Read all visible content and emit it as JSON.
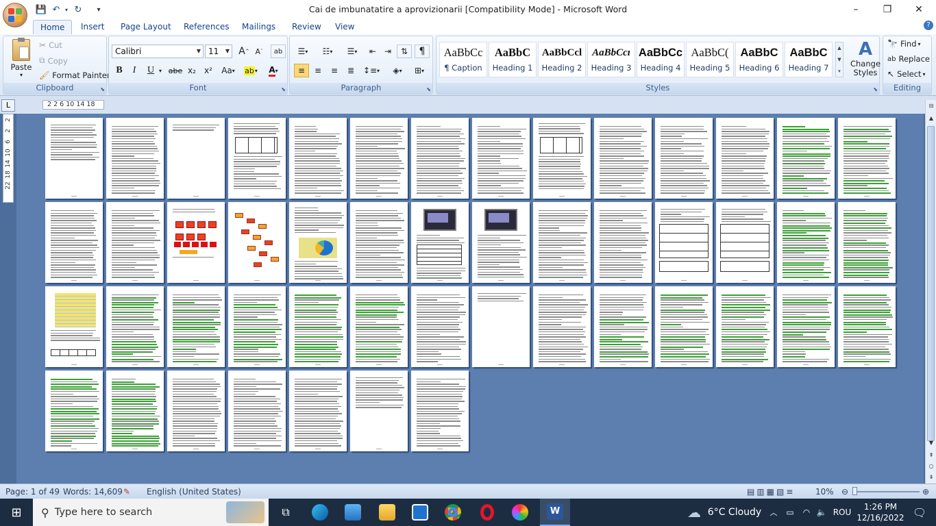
{
  "window": {
    "title": "Cai de imbunatatire a aprovizionarii [Compatibility Mode] - Microsoft Word",
    "controls": {
      "minimize": "–",
      "restore": "❐",
      "close": "✕"
    }
  },
  "quick_access": {
    "save": "💾",
    "undo": "↶",
    "redo": "↻",
    "customize": "▾"
  },
  "tabs": [
    "Home",
    "Insert",
    "Page Layout",
    "References",
    "Mailings",
    "Review",
    "View"
  ],
  "active_tab": "Home",
  "help_icon": "?",
  "clipboard": {
    "label": "Clipboard",
    "paste": "Paste",
    "cut": "Cut",
    "copy": "Copy",
    "format_painter": "Format Painter"
  },
  "font": {
    "label": "Font",
    "family": "Calibri",
    "size": "11",
    "grow": "A",
    "shrink": "A",
    "bold": "B",
    "italic": "I",
    "underline": "U",
    "strike": "abe",
    "subscript": "x₂",
    "superscript": "x²",
    "change_case": "Aa",
    "highlight": "ab",
    "font_color": "A"
  },
  "paragraph": {
    "label": "Paragraph",
    "show_marks": "¶"
  },
  "styles": {
    "label": "Styles",
    "items": [
      {
        "preview": "AaBbCc",
        "name": "¶ Caption"
      },
      {
        "preview": "AaBbC",
        "name": "Heading 1"
      },
      {
        "preview": "AaBbCcl",
        "name": "Heading 2"
      },
      {
        "preview": "AaBbCcı",
        "name": "Heading 3"
      },
      {
        "preview": "AaBbCc",
        "name": "Heading 4"
      },
      {
        "preview": "AaBbC(",
        "name": "Heading 5"
      },
      {
        "preview": "AaBbC",
        "name": "Heading 6"
      },
      {
        "preview": "AaBbC",
        "name": "Heading 7"
      }
    ],
    "change_styles": "Change Styles"
  },
  "editing": {
    "label": "Editing",
    "find": "Find",
    "replace": "Replace",
    "select": "Select"
  },
  "ruler": {
    "corner": "L",
    "marks": "2  2   6   10   14  18"
  },
  "vruler_marks": [
    "2",
    "2",
    "6",
    "10",
    "14",
    "18",
    "22"
  ],
  "status": {
    "page": "Page: 1 of 49",
    "words": "Words: 14,609",
    "language": "English (United States)",
    "zoom": "10%"
  },
  "taskbar": {
    "search_placeholder": "Type here to search",
    "weather": "6°C  Cloudy",
    "lang": "ROU",
    "time": "1:26 PM",
    "date": "12/16/2022"
  },
  "colors": {
    "ribbon_bg": "#dde8f6",
    "canvas_bg": "#5c7fb0",
    "highlight_green": "#3aa035",
    "taskbar_bg": "#1c2d42"
  }
}
